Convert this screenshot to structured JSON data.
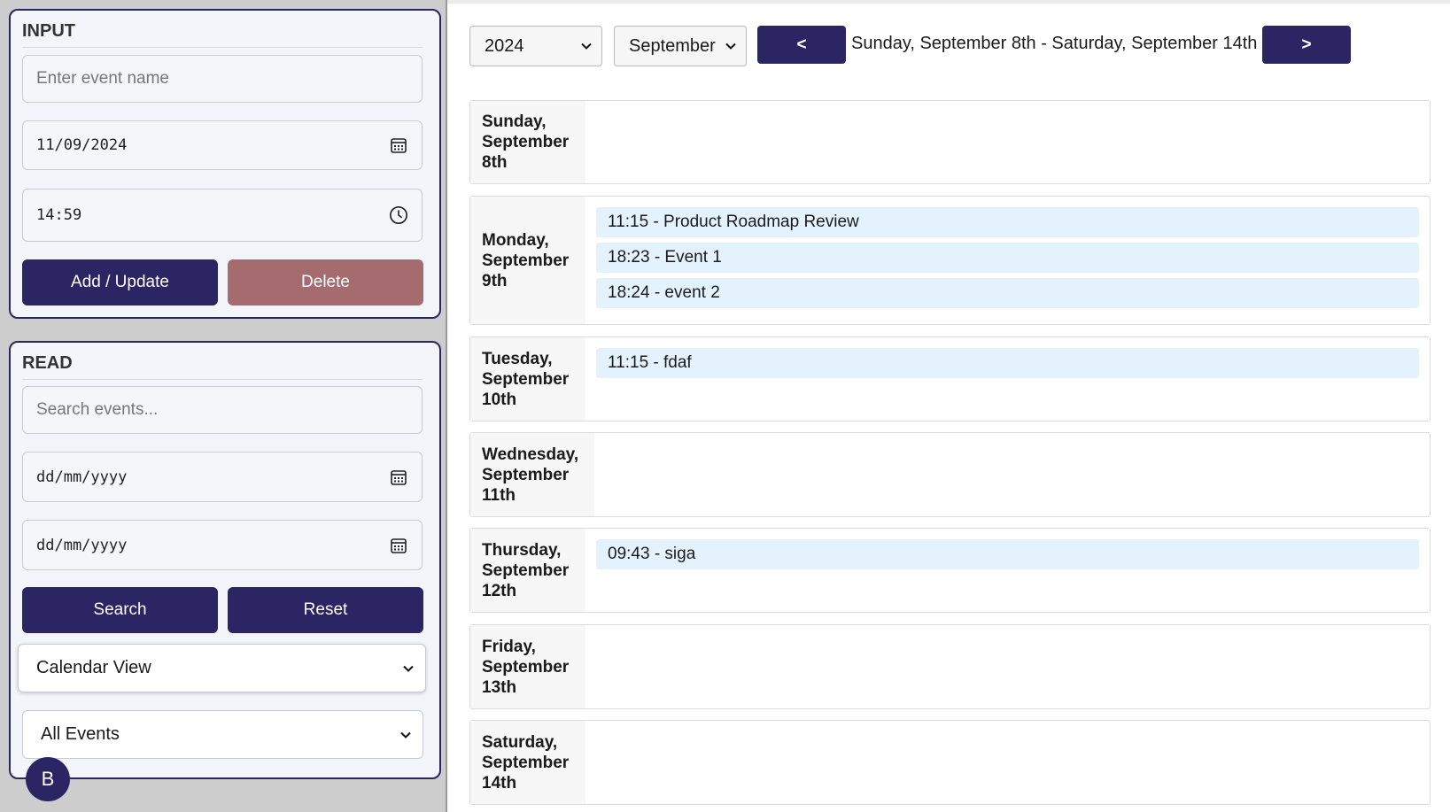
{
  "input_panel": {
    "title": "INPUT",
    "event_name_placeholder": "Enter event name",
    "date_value": "11/09/2024",
    "time_value": "14:59",
    "add_update_label": "Add / Update",
    "delete_label": "Delete"
  },
  "read_panel": {
    "title": "READ",
    "search_placeholder": "Search events...",
    "from_date_placeholder": "dd/mm/yyyy",
    "to_date_placeholder": "dd/mm/yyyy",
    "search_label": "Search",
    "reset_label": "Reset",
    "view_select_value": "Calendar View",
    "filter_select_value": "All Events"
  },
  "avatar": {
    "initial": "B"
  },
  "nav": {
    "year_value": "2024",
    "month_value": "September",
    "prev_label": "<",
    "next_label": ">",
    "range_label": "Sunday, September 8th - Saturday, September 14th"
  },
  "colors": {
    "primary": "#2b2563",
    "danger": "#a56c70",
    "event_bg": "#e4f2fd"
  },
  "days": [
    {
      "line1": "Sunday,",
      "line2": "September",
      "line3": "8th",
      "events": []
    },
    {
      "line1": "Monday,",
      "line2": "September",
      "line3": "9th",
      "events": [
        "11:15 - Product Roadmap Review",
        "18:23 - Event 1",
        "18:24 - event 2"
      ]
    },
    {
      "line1": "Tuesday,",
      "line2": "September",
      "line3": "10th",
      "events": [
        "11:15 - fdaf"
      ]
    },
    {
      "line1": "Wednesday,",
      "line2": "September",
      "line3": "11th",
      "events": []
    },
    {
      "line1": "Thursday,",
      "line2": "September",
      "line3": "12th",
      "events": [
        "09:43 - siga"
      ]
    },
    {
      "line1": "Friday,",
      "line2": "September",
      "line3": "13th",
      "events": []
    },
    {
      "line1": "Saturday,",
      "line2": "September",
      "line3": "14th",
      "events": []
    }
  ]
}
